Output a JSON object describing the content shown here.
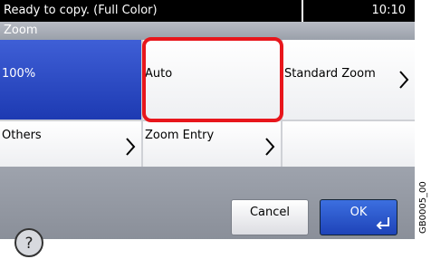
{
  "status": {
    "message": "Ready to copy. (Full Color)",
    "time": "10:10"
  },
  "screen": {
    "title": "Zoom"
  },
  "options": {
    "p100": "100%",
    "auto": "Auto",
    "standard": "Standard Zoom",
    "others": "Others",
    "entry": "Zoom Entry"
  },
  "footer": {
    "cancel": "Cancel",
    "ok": "OK"
  },
  "side_code": "GB0005_00",
  "colors": {
    "accent": "#1d3ab2",
    "highlight": "#e8161c"
  },
  "icons": {
    "help": "help-icon",
    "chevron": "chevron-right-icon",
    "enter": "enter-icon"
  }
}
